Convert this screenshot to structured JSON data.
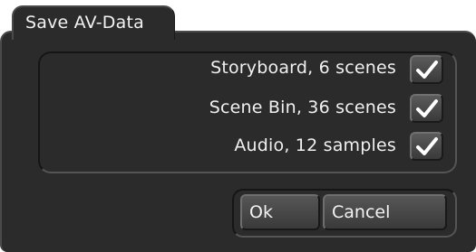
{
  "dialog": {
    "title": "Save AV-Data",
    "options": [
      {
        "label": "Storyboard, 6 scenes",
        "checked": true
      },
      {
        "label": "Scene Bin, 36 scenes",
        "checked": true
      },
      {
        "label": "Audio, 12 samples",
        "checked": true
      }
    ],
    "buttons": {
      "ok_label": "Ok",
      "cancel_label": "Cancel"
    }
  },
  "colors": {
    "background": "#2b2b2b",
    "text": "#f0f0f0",
    "button": "#4a4a4a"
  },
  "icons": {
    "check": "checkmark-icon"
  }
}
